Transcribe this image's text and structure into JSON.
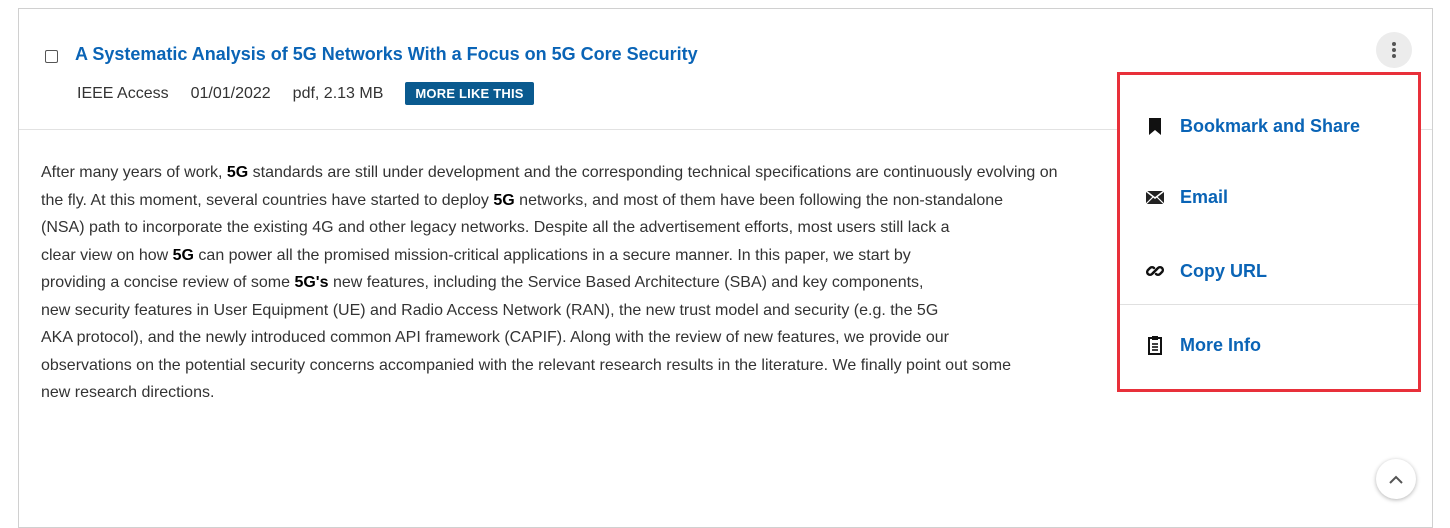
{
  "result": {
    "title": "A Systematic Analysis of 5G Networks With a Focus on 5G Core Security",
    "journal": "IEEE Access",
    "date": "01/01/2022",
    "file_info": "pdf, 2.13 MB",
    "more_like_this_label": "MORE LIKE THIS"
  },
  "abstract": {
    "lines": [
      [
        {
          "t": "After many years of work, "
        },
        {
          "t": "5G",
          "b": true
        },
        {
          "t": " standards are still under development and the corresponding technical specifications are continuously evolving on"
        }
      ],
      [
        {
          "t": "the fly. At this moment, several countries have started to deploy "
        },
        {
          "t": "5G",
          "b": true
        },
        {
          "t": " networks, and most of them have been following the non-standalone"
        }
      ],
      [
        {
          "t": "(NSA) path to incorporate the existing 4G and other legacy networks. Despite all the advertisement efforts, most users still lack a"
        }
      ],
      [
        {
          "t": "clear view on how "
        },
        {
          "t": "5G",
          "b": true
        },
        {
          "t": " can power all the promised mission-critical applications in a secure manner. In this paper, we start by"
        }
      ],
      [
        {
          "t": "providing a concise review of some "
        },
        {
          "t": "5G's",
          "b": true
        },
        {
          "t": " new features, including the Service Based Architecture (SBA) and key components,"
        }
      ],
      [
        {
          "t": "new security features in User Equipment (UE) and Radio Access Network (RAN), the new trust model and security (e.g. the 5G"
        }
      ],
      [
        {
          "t": "AKA protocol), and the newly introduced common API framework (CAPIF). Along with the review of new features, we provide our"
        }
      ],
      [
        {
          "t": "observations on the potential security concerns accompanied with the relevant research results in the literature. We finally point out some"
        }
      ],
      [
        {
          "t": "new research directions."
        }
      ]
    ]
  },
  "menu": {
    "items": [
      {
        "label": "Bookmark and Share",
        "icon": "bookmark-icon"
      },
      {
        "label": "Email",
        "icon": "envelope-icon"
      },
      {
        "label": "Copy URL",
        "icon": "link-icon"
      },
      {
        "label": "More Info",
        "icon": "clipboard-icon"
      }
    ]
  },
  "colors": {
    "link": "#0a64b6",
    "badge_bg": "#0a5a8f",
    "highlight_border": "#e8303a"
  }
}
